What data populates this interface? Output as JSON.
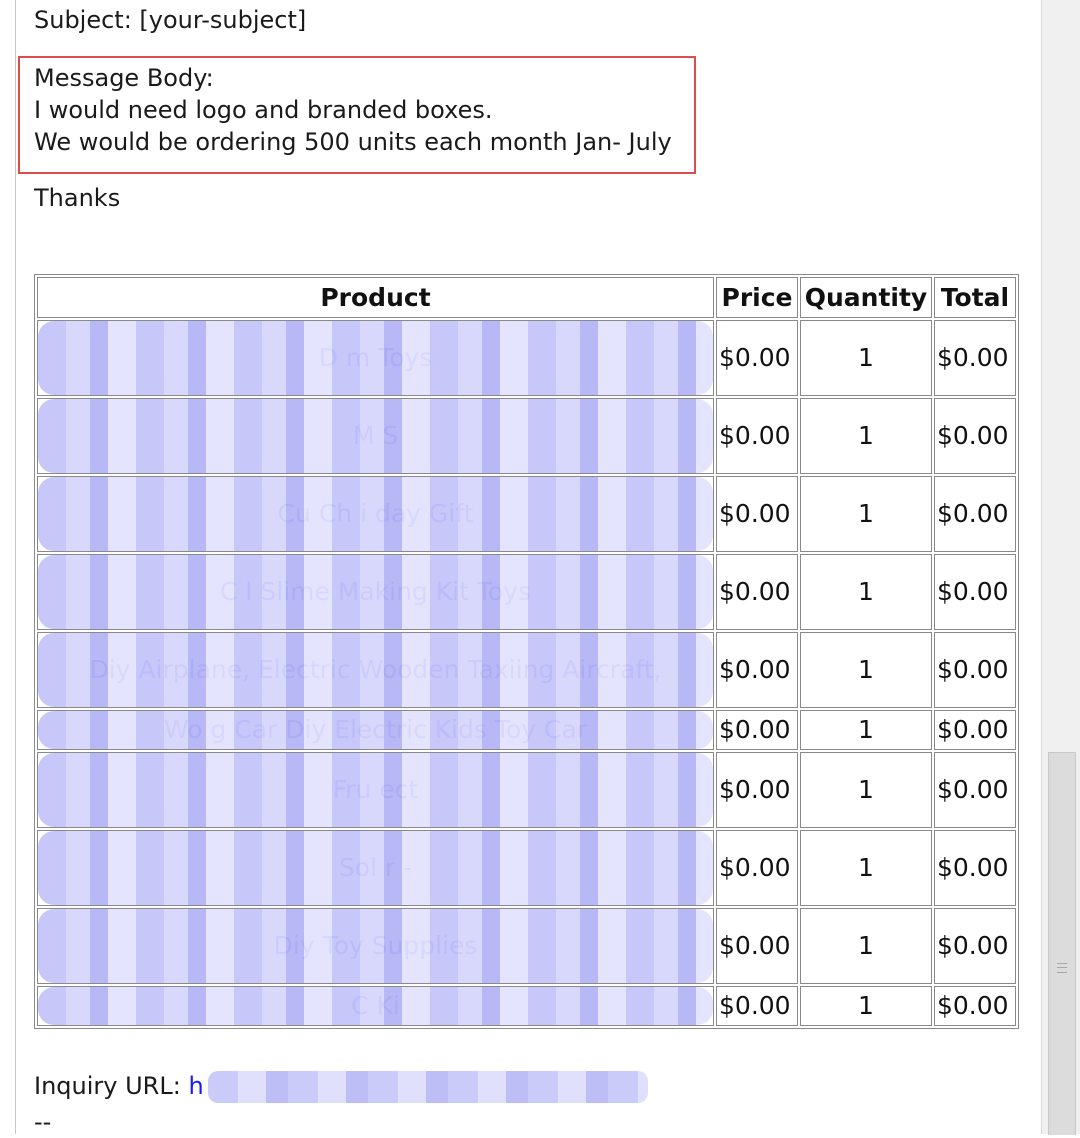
{
  "email": {
    "subject_line": "Subject: [your-subject]",
    "message_body_label": "Message Body:",
    "message_lines": [
      "I would need logo and branded boxes.",
      "We would be ordering 500 units each month Jan- July"
    ],
    "closing": "Thanks",
    "inquiry_label": "Inquiry URL:",
    "inquiry_url_visible": "h",
    "signature_dashes": "--"
  },
  "product_table": {
    "headers": [
      "Product",
      "Price",
      "Quantity",
      "Total"
    ],
    "rows": [
      {
        "name": "D                                          m Toys",
        "price": "$0.00",
        "qty": "1",
        "total": "$0.00"
      },
      {
        "name": "M                                          S",
        "price": "$0.00",
        "qty": "1",
        "total": "$0.00"
      },
      {
        "name": "Cu                  Ch           i                 day Gift",
        "price": "$0.00",
        "qty": "1",
        "total": "$0.00"
      },
      {
        "name": "C                    l Slime Making Kit Toys",
        "price": "$0.00",
        "qty": "1",
        "total": "$0.00"
      },
      {
        "name": "Diy Airplane, Electric Wooden Taxiing Aircraft,",
        "price": "$0.00",
        "qty": "1",
        "total": "$0.00"
      },
      {
        "name": "Wo                  g Car Diy Electric Kids Toy Car",
        "price": "$0.00",
        "qty": "1",
        "total": "$0.00"
      },
      {
        "name": "Fru                                      ect",
        "price": "$0.00",
        "qty": "1",
        "total": "$0.00"
      },
      {
        "name": "Sol                                        r -",
        "price": "$0.00",
        "qty": "1",
        "total": "$0.00"
      },
      {
        "name": "Diy                                     Toy Supplies",
        "price": "$0.00",
        "qty": "1",
        "total": "$0.00"
      },
      {
        "name": "C                                       Ki",
        "price": "$0.00",
        "qty": "1",
        "total": "$0.00"
      }
    ]
  }
}
